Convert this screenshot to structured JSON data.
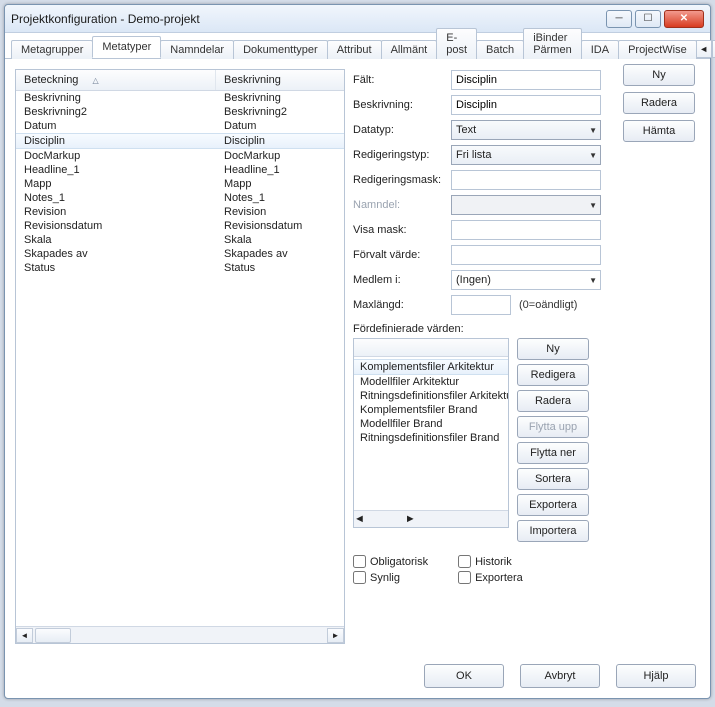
{
  "title": "Projektkonfiguration - Demo-projekt",
  "tabs": [
    "Metagrupper",
    "Metatyper",
    "Namndelar",
    "Dokumenttyper",
    "Attribut",
    "Allmänt",
    "E-post",
    "Batch",
    "iBinder Pärmen",
    "IDA",
    "ProjectWise"
  ],
  "activeTab": 1,
  "list": {
    "col1": "Beteckning",
    "col2": "Beskrivning",
    "rows": [
      {
        "a": "Beskrivning",
        "b": "Beskrivning"
      },
      {
        "a": "Beskrivning2",
        "b": "Beskrivning2"
      },
      {
        "a": "Datum",
        "b": "Datum"
      },
      {
        "a": "Disciplin",
        "b": "Disciplin",
        "sel": true
      },
      {
        "a": "DocMarkup",
        "b": "DocMarkup"
      },
      {
        "a": "Headline_1",
        "b": "Headline_1"
      },
      {
        "a": "Mapp",
        "b": "Mapp"
      },
      {
        "a": "Notes_1",
        "b": "Notes_1"
      },
      {
        "a": "Revision",
        "b": "Revision"
      },
      {
        "a": "Revisionsdatum",
        "b": "Revisionsdatum"
      },
      {
        "a": "Skala",
        "b": "Skala"
      },
      {
        "a": "Skapades av",
        "b": "Skapades av"
      },
      {
        "a": "Status",
        "b": "Status"
      }
    ]
  },
  "form": {
    "faltLabel": "Fält:",
    "faltValue": "Disciplin",
    "beskLabel": "Beskrivning:",
    "beskValue": "Disciplin",
    "datatypLabel": "Datatyp:",
    "datatypValue": "Text",
    "redtypLabel": "Redigeringstyp:",
    "redtypValue": "Fri lista",
    "redmaskLabel": "Redigeringsmask:",
    "redmaskValue": "",
    "namndelLabel": "Namndel:",
    "namndelValue": "",
    "visamaskLabel": "Visa mask:",
    "visamaskValue": "",
    "forvaltLabel": "Förvalt värde:",
    "forvaltValue": "",
    "medlemLabel": "Medlem i:",
    "medlemValue": "(Ingen)",
    "maxlLabel": "Maxlängd:",
    "maxlValue": "",
    "maxlNote": "(0=oändligt)"
  },
  "predef": {
    "label": "Fördefinierade värden:",
    "items": [
      {
        "t": "Komplementsfiler Arkitektur",
        "sel": true
      },
      {
        "t": "Modellfiler Arkitektur"
      },
      {
        "t": "Ritningsdefinitionsfiler Arkitektu"
      },
      {
        "t": "Komplementsfiler Brand"
      },
      {
        "t": "Modellfiler Brand"
      },
      {
        "t": "Ritningsdefinitionsfiler Brand"
      }
    ],
    "btns": {
      "ny": "Ny",
      "redigera": "Redigera",
      "radera": "Radera",
      "flyttaupp": "Flytta upp",
      "flyttaner": "Flytta ner",
      "sortera": "Sortera",
      "exportera": "Exportera",
      "importera": "Importera"
    }
  },
  "side": {
    "ny": "Ny",
    "radera": "Radera",
    "hamta": "Hämta"
  },
  "checks": {
    "oblig": "Obligatorisk",
    "historik": "Historik",
    "synlig": "Synlig",
    "exportera": "Exportera"
  },
  "footer": {
    "ok": "OK",
    "avbryt": "Avbryt",
    "hjalp": "Hjälp"
  }
}
